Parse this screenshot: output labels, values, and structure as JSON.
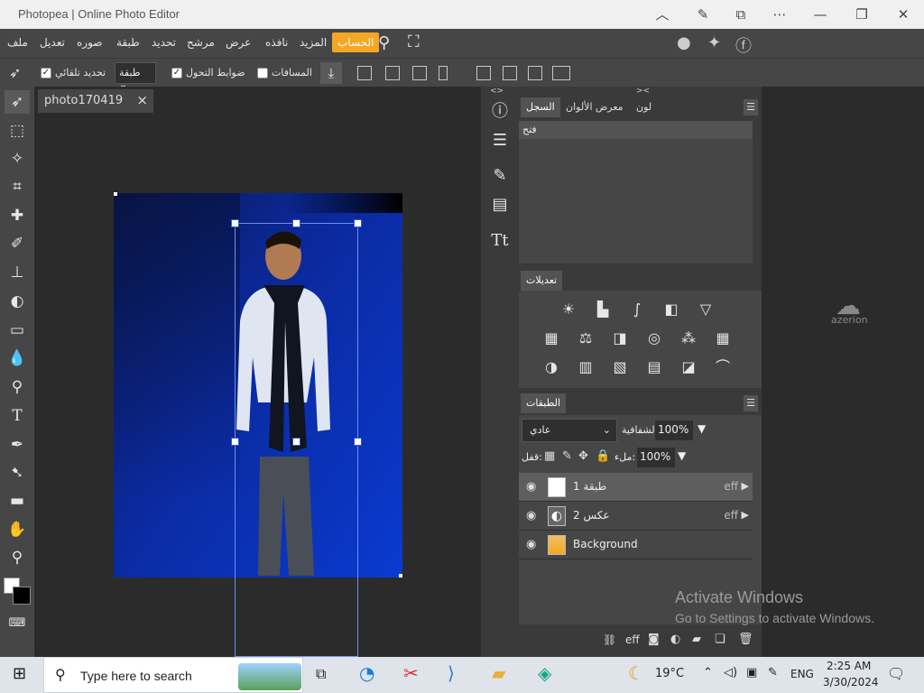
{
  "window": {
    "title": "Photopea | Online Photo Editor"
  },
  "menu": {
    "items": [
      "ملف",
      "تعديل",
      "صوره",
      "طبقة",
      "تحديد",
      "مرشح",
      "عرض",
      "نافذه",
      "المزيد"
    ],
    "account": "الحساب"
  },
  "options": {
    "auto_select_label": "تحديد تلقائي",
    "auto_select_value": "طبقة",
    "transform_controls_label": "ضوابط التحول",
    "distances_label": "المسافات"
  },
  "document": {
    "tab_name": "photo170419",
    "close_icon": "×"
  },
  "history_panel": {
    "tabs": [
      "السجل",
      "معرض الألوان",
      "لون"
    ],
    "active_tab": "السجل",
    "items": [
      "فتح"
    ]
  },
  "adjustments_panel": {
    "title": "تعديلات"
  },
  "layers_panel": {
    "title": "الطبقات",
    "blend_mode": "عادي",
    "opacity_label": "الشفافية:",
    "opacity_value": "100%",
    "lock_label": "قفل:",
    "fill_label": "ملء:",
    "fill_value": "100%",
    "layers": [
      {
        "name": "طبقة 1",
        "fx": "eff",
        "selected": true
      },
      {
        "name": "عكس 2",
        "fx": "eff",
        "selected": false
      },
      {
        "name": "Background",
        "fx": "",
        "selected": false
      }
    ],
    "footer_fx": "eff"
  },
  "watermark": {
    "line1": "Activate Windows",
    "line2": "Go to Settings to activate Windows."
  },
  "brand": "azerion",
  "taskbar": {
    "search_placeholder": "Type here to search",
    "weather_temp": "19°C",
    "language": "ENG",
    "time": "2:25 AM",
    "date": "3/30/2024"
  },
  "colors": {
    "accent": "#f5a623",
    "panel": "#464646",
    "canvas_blue": "#0b2aa0"
  }
}
